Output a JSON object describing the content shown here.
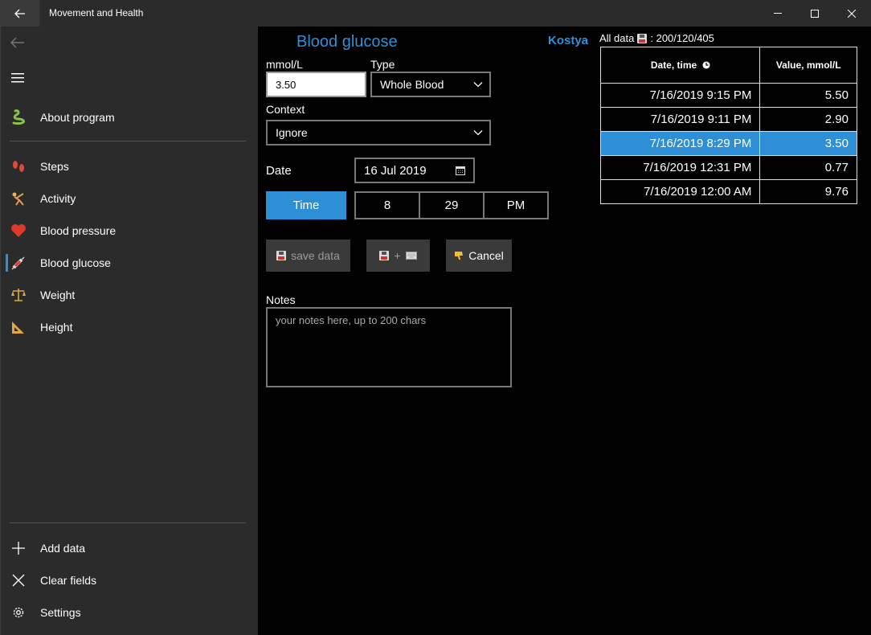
{
  "window": {
    "title": "Movement and Health"
  },
  "sidebar": {
    "items": [
      {
        "label": "About program",
        "icon": "snake-icon"
      },
      {
        "label": "Steps",
        "icon": "footprints-icon"
      },
      {
        "label": "Activity",
        "icon": "gymnast-icon"
      },
      {
        "label": "Blood pressure",
        "icon": "heart-icon"
      },
      {
        "label": "Blood glucose",
        "icon": "syringe-icon"
      },
      {
        "label": "Weight",
        "icon": "scales-icon"
      },
      {
        "label": "Height",
        "icon": "triangle-ruler-icon"
      }
    ],
    "bottom": [
      {
        "label": "Add data",
        "icon": "plus-icon"
      },
      {
        "label": "Clear fields",
        "icon": "x-icon"
      },
      {
        "label": "Settings",
        "icon": "gear-icon"
      }
    ],
    "selected": "Blood glucose"
  },
  "header": {
    "title": "Blood glucose",
    "user": "Kostya",
    "all_data_label": "All data",
    "all_data_counts": ": 200/120/405"
  },
  "form": {
    "value_label": "mmol/L",
    "value": "3.50",
    "type_label": "Type",
    "type_value": "Whole Blood",
    "context_label": "Context",
    "context_value": "Ignore",
    "date_label": "Date",
    "date_value": "16 Jul 2019",
    "time_label": "Time",
    "hour": "8",
    "minute": "29",
    "ampm": "PM",
    "save_label": "save data",
    "save_plus": "+",
    "cancel_label": "Cancel",
    "notes_label": "Notes",
    "notes_placeholder": "your notes here, up to 200 chars"
  },
  "table": {
    "headers": [
      "Date, time",
      "Value, mmol/L"
    ],
    "rows": [
      {
        "datetime": "7/16/2019 9:15 PM",
        "value": "5.50"
      },
      {
        "datetime": "7/16/2019 9:11 PM",
        "value": "2.90"
      },
      {
        "datetime": "7/16/2019 8:29 PM",
        "value": "3.50"
      },
      {
        "datetime": "7/16/2019 12:31 PM",
        "value": "0.77"
      },
      {
        "datetime": "7/16/2019 12:00 AM",
        "value": "9.76"
      }
    ],
    "selected_row": 2
  },
  "colors": {
    "accent": "#2f8fd6",
    "sidebar": "#2b2b2b",
    "background": "#000000"
  }
}
